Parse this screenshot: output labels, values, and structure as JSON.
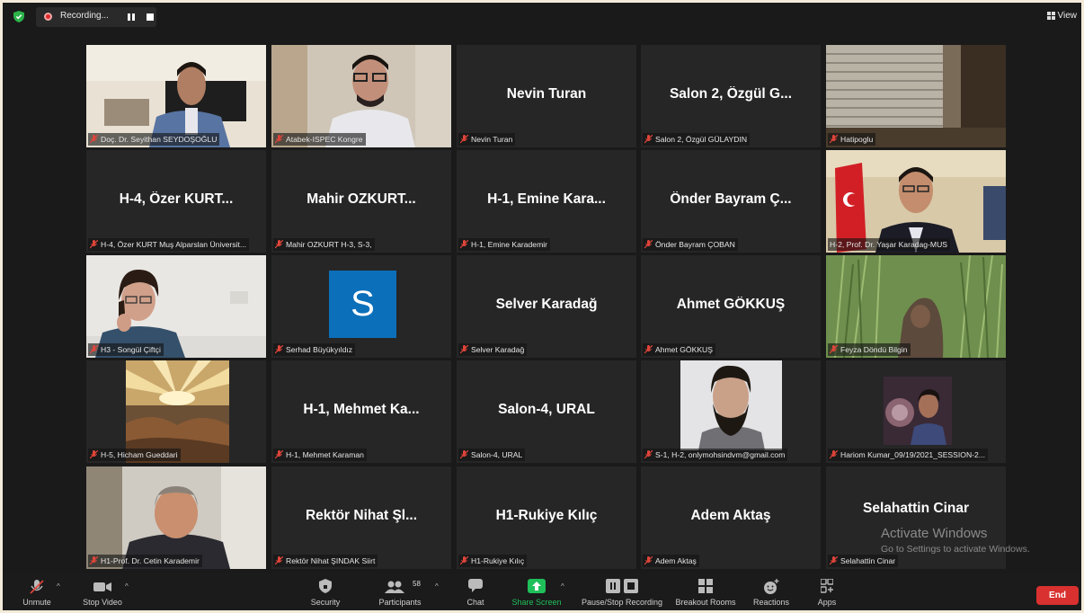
{
  "topbar": {
    "recording_label": "Recording...",
    "view_label": "View"
  },
  "tiles": [
    {
      "label": "Doç. Dr. Seyithan SEYDOŞOĞLU"
    },
    {
      "label": "Atabek-ISPEC Kongre"
    },
    {
      "name": "Nevin Turan",
      "label": "Nevin Turan"
    },
    {
      "name": "Salon 2, Özgül G...",
      "label": "Salon 2, Özgül GÜLAYDIN"
    },
    {
      "label": "Hatipoglu"
    },
    {
      "name": "H-4, Özer KURT...",
      "label": "H-4, Özer KURT Muş Alparslan Üniversit..."
    },
    {
      "name": "Mahir OZKURT...",
      "label": "Mahir OZKURT H-3, S-3,"
    },
    {
      "name": "H-1, Emine Kara...",
      "label": "H-1, Emine Karademir"
    },
    {
      "name": "Önder Bayram Ç...",
      "label": "Önder Bayram ÇOBAN"
    },
    {
      "label": "H-2, Prof. Dr. Yaşar Karadag-MUS"
    },
    {
      "label": "H3 - Songül Çiftçi"
    },
    {
      "avatar_letter": "S",
      "label": "Serhad Büyükyıldız"
    },
    {
      "name": "Selver Karadağ",
      "label": "Selver Karadağ"
    },
    {
      "name": "Ahmet GÖKKUŞ",
      "label": "Ahmet GÖKKUŞ"
    },
    {
      "label": "Feyza Döndü Bilgin"
    },
    {
      "label": "H-5, Hicham Gueddari"
    },
    {
      "name": "H-1, Mehmet Ka...",
      "label": "H-1, Mehmet Karaman"
    },
    {
      "name": "Salon-4, URAL",
      "label": "Salon-4, URAL"
    },
    {
      "label": "S-1, H-2, onlymohsindvm@gmail.com"
    },
    {
      "label": "Hariom Kumar_09/19/2021_SESSION-2..."
    },
    {
      "label": "H1-Prof. Dr. Cetin Karademir"
    },
    {
      "name": "Rektör Nihat Şl...",
      "label": "Rektör Nihat ŞINDAK Siirt"
    },
    {
      "name": "H1-Rukiye Kılıç",
      "label": "H1-Rukiye Kılıç"
    },
    {
      "name": "Adem Aktaş",
      "label": "Adem Aktaş"
    },
    {
      "name": "Selahattin Cinar",
      "label": "Selahattin Cinar"
    }
  ],
  "watermark": {
    "line1": "Activate Windows",
    "line2": "Go to Settings to activate Windows."
  },
  "toolbar": {
    "unmute": "Unmute",
    "stop_video": "Stop Video",
    "security": "Security",
    "participants": "Participants",
    "participants_count": "58",
    "chat": "Chat",
    "share_screen": "Share Screen",
    "pause_stop_recording": "Pause/Stop Recording",
    "breakout_rooms": "Breakout Rooms",
    "reactions": "Reactions",
    "apps": "Apps",
    "end": "End"
  },
  "colors": {
    "share_green": "#1fbf5a",
    "end_red": "#d8312f",
    "speaker_outline": "#dfe84e",
    "avatar_blue": "#0c6fba"
  }
}
